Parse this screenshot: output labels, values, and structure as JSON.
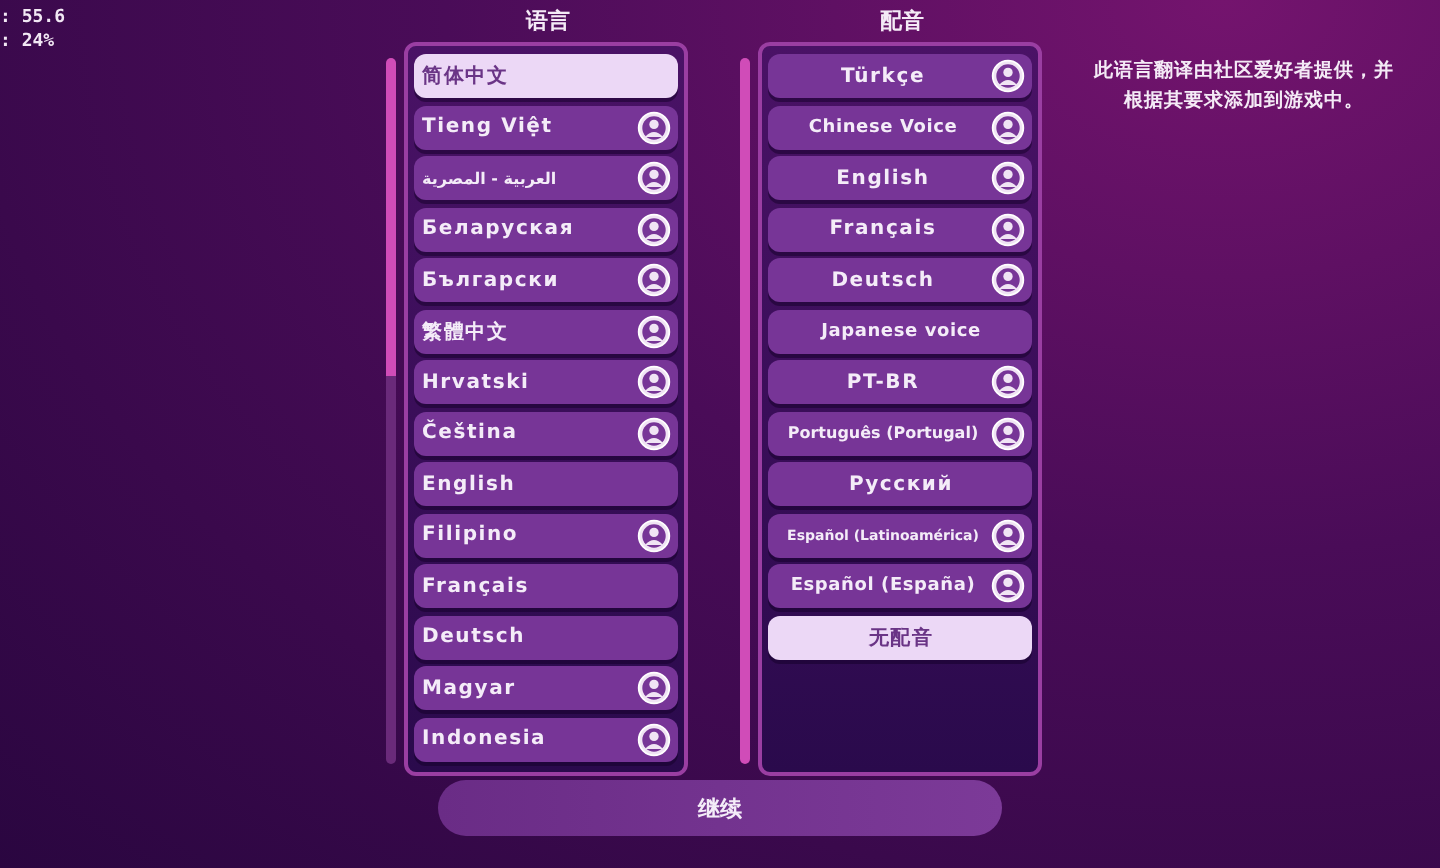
{
  "debug_overlay": [
    ": 55.6",
    ": 24%"
  ],
  "language": {
    "title": "语言",
    "items": [
      {
        "label": "简体中文",
        "selected": true,
        "community": false
      },
      {
        "label": "Tieng Việt",
        "selected": false,
        "community": true
      },
      {
        "label": "العربية - المصرية",
        "selected": false,
        "community": true
      },
      {
        "label": "Беларуская",
        "selected": false,
        "community": true
      },
      {
        "label": "Български",
        "selected": false,
        "community": true
      },
      {
        "label": "繁體中文",
        "selected": false,
        "community": true
      },
      {
        "label": "Hrvatski",
        "selected": false,
        "community": true
      },
      {
        "label": "Čeština",
        "selected": false,
        "community": true
      },
      {
        "label": "English",
        "selected": false,
        "community": false
      },
      {
        "label": "Filipino",
        "selected": false,
        "community": true
      },
      {
        "label": "Français",
        "selected": false,
        "community": false
      },
      {
        "label": "Deutsch",
        "selected": false,
        "community": false
      },
      {
        "label": "Magyar",
        "selected": false,
        "community": true
      },
      {
        "label": "Indonesia",
        "selected": false,
        "community": true
      }
    ]
  },
  "voice": {
    "title": "配音",
    "items": [
      {
        "label": "Türkçe",
        "selected": false,
        "community": true
      },
      {
        "label": "Chinese Voice",
        "selected": false,
        "community": true
      },
      {
        "label": "English",
        "selected": false,
        "community": true
      },
      {
        "label": "Français",
        "selected": false,
        "community": true
      },
      {
        "label": "Deutsch",
        "selected": false,
        "community": true
      },
      {
        "label": "Japanese voice",
        "selected": false,
        "community": false
      },
      {
        "label": "PT-BR",
        "selected": false,
        "community": true
      },
      {
        "label": "Português (Portugal)",
        "selected": false,
        "community": true
      },
      {
        "label": "Русский",
        "selected": false,
        "community": false
      },
      {
        "label": "Español (Latinoamérica)",
        "selected": false,
        "community": true
      },
      {
        "label": "Español (España)",
        "selected": false,
        "community": true
      },
      {
        "label": "无配音",
        "selected": true,
        "community": false
      }
    ]
  },
  "note": "此语言翻译由社区爱好者提供，并根据其要求添加到游戏中。",
  "continue_button": "继续"
}
